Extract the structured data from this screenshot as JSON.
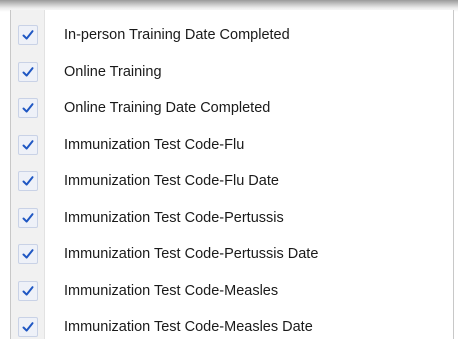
{
  "menu": {
    "items": [
      {
        "label": "In-person Training Date Completed",
        "checked": true
      },
      {
        "label": "Online Training",
        "checked": true
      },
      {
        "label": "Online Training Date Completed",
        "checked": true
      },
      {
        "label": "Immunization Test Code-Flu",
        "checked": true
      },
      {
        "label": "Immunization Test Code-Flu Date",
        "checked": true
      },
      {
        "label": "Immunization Test Code-Pertussis",
        "checked": true
      },
      {
        "label": "Immunization Test Code-Pertussis Date",
        "checked": true
      },
      {
        "label": "Immunization Test Code-Measles",
        "checked": true
      },
      {
        "label": "Immunization Test Code-Measles Date",
        "checked": true
      }
    ],
    "check_icon": "checkmark-icon",
    "check_color": "#1f57c3"
  }
}
